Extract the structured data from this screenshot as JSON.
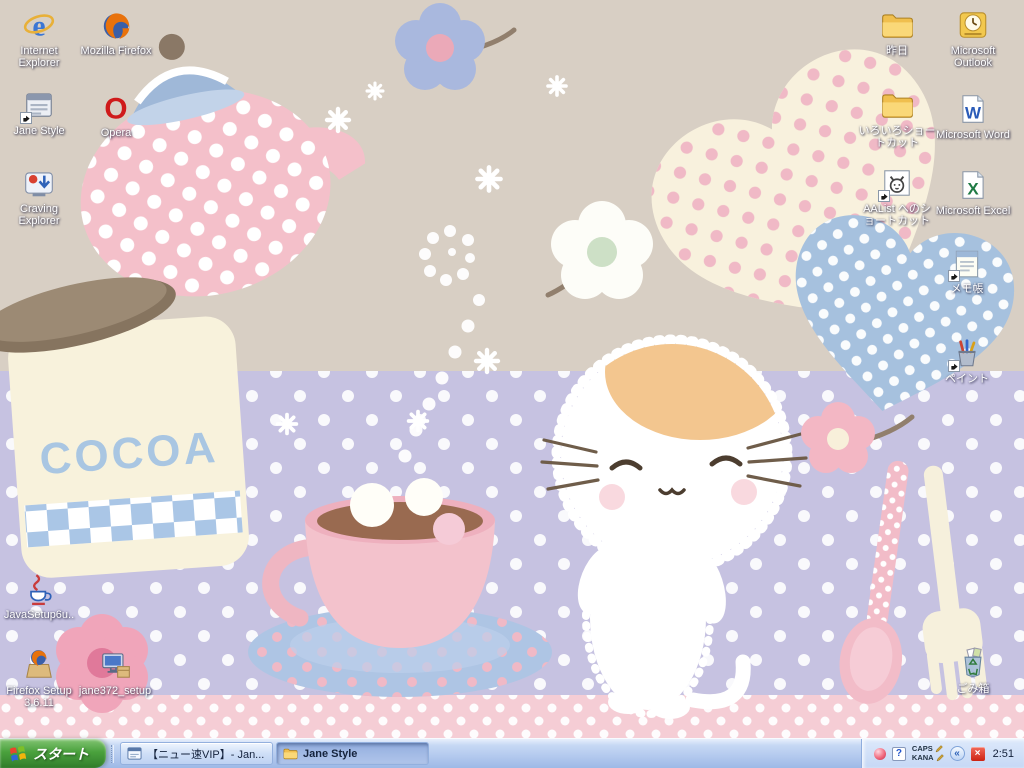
{
  "wallpaper": {
    "jar_label": "COCOA"
  },
  "desktop": {
    "icons": [
      {
        "id": "internet-explorer",
        "label": "Internet Explorer"
      },
      {
        "id": "mozilla-firefox",
        "label": "Mozilla Firefox"
      },
      {
        "id": "jane-style",
        "label": "Jane Style"
      },
      {
        "id": "opera",
        "label": "Opera"
      },
      {
        "id": "craving-explorer",
        "label": "Craving Explorer"
      },
      {
        "id": "javasetup",
        "label": "JavaSetup6u.."
      },
      {
        "id": "firefox-setup",
        "label": "Firefox Setup 3.6.11"
      },
      {
        "id": "jane372-setup",
        "label": "jane372_setup"
      },
      {
        "id": "folder-yesterday",
        "label": "昨日"
      },
      {
        "id": "microsoft-outlook",
        "label": "Microsoft Outlook"
      },
      {
        "id": "folder-shortcuts",
        "label": "いろいろショートカット"
      },
      {
        "id": "microsoft-word",
        "label": "Microsoft Word"
      },
      {
        "id": "aalist-shortcut",
        "label": "AAList へのショートカット"
      },
      {
        "id": "microsoft-excel",
        "label": "Microsoft Excel"
      },
      {
        "id": "notepad",
        "label": "メモ帳"
      },
      {
        "id": "paint",
        "label": "ペイント"
      },
      {
        "id": "recycle-bin",
        "label": "ごみ箱"
      }
    ]
  },
  "taskbar": {
    "start_label": "スタート",
    "tasks": [
      {
        "label": "【ニュー速VIP】- Jan..."
      },
      {
        "label": "Jane Style"
      }
    ],
    "tray": {
      "caps": "CAPS",
      "kana": "KANA",
      "time": "2:51"
    }
  },
  "glyphs": {
    "ie_e": "e",
    "opera_o": "O",
    "word_w": "W",
    "excel_x": "X",
    "help": "?",
    "alert_x": "×",
    "tray_chevron": "«"
  }
}
